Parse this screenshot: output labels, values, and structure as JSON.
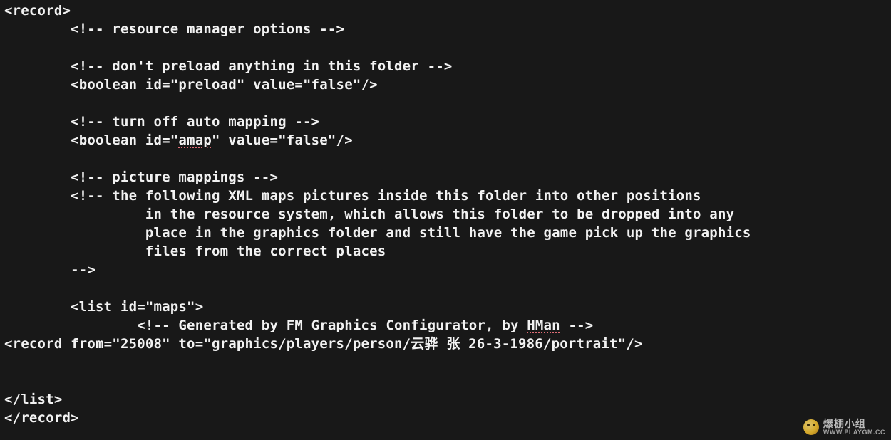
{
  "code": {
    "lines": [
      "<record>",
      "        <!-- resource manager options -->",
      "",
      "        <!-- don't preload anything in this folder -->",
      "        <boolean id=\"preload\" value=\"false\"/>",
      "",
      "        <!-- turn off auto mapping -->",
      "        <boolean id=\"amap\" value=\"false\"/>",
      "",
      "        <!-- picture mappings -->",
      "        <!-- the following XML maps pictures inside this folder into other positions",
      "                 in the resource system, which allows this folder to be dropped into any",
      "                 place in the graphics folder and still have the game pick up the graphics",
      "                 files from the correct places",
      "        -->",
      "",
      "        <list id=\"maps\">",
      "                <!-- Generated by FM Graphics Configurator, by HMan -->",
      "<record from=\"25008\" to=\"graphics/players/person/云骅 张 26-3-1986/portrait\"/>",
      "",
      "",
      "</list>",
      "</record>"
    ],
    "spellcheck_tokens": [
      "amap",
      "HMan"
    ]
  },
  "watermark": {
    "line1": "爆棚小组",
    "line2": "WWW.PLAYGM.CC"
  }
}
